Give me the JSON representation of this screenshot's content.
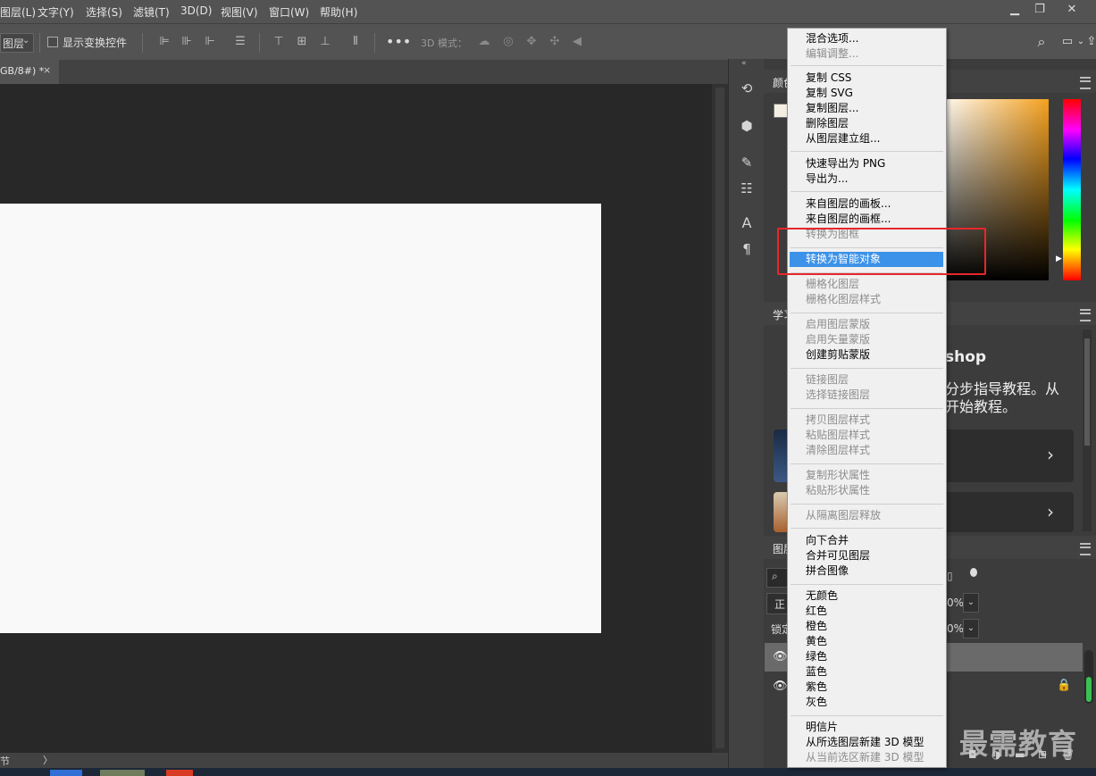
{
  "menubar": {
    "items": [
      "图层(L)",
      "文字(Y)",
      "选择(S)",
      "滤镜(T)",
      "3D(D)",
      "视图(V)",
      "窗口(W)",
      "帮助(H)"
    ],
    "window_controls": [
      "minimize-icon",
      "restore-icon",
      "close-icon"
    ]
  },
  "options": {
    "layer_select": "图层",
    "show_transform": "显示变换控件",
    "mode_3d": "3D 模式："
  },
  "tab": {
    "title": "GB/8#) *",
    "close": "×"
  },
  "status": {
    "left": "节",
    "arrow": "〉"
  },
  "panels": {
    "color_tab": "颜色",
    "learn_tab": "学习",
    "learn_heading": "shop",
    "learn_line1": "分步指导教程。从",
    "learn_line2": "开始教程。",
    "layers_tab": "图层",
    "blend_mode": "正",
    "opacity": "0%",
    "fill": "0%",
    "lock_label": "锁定"
  },
  "context_menu": {
    "items": [
      {
        "label": "混合选项...",
        "enabled": true
      },
      {
        "label": "编辑调整...",
        "enabled": false
      },
      {
        "label": "复制 CSS",
        "enabled": true
      },
      {
        "label": "复制 SVG",
        "enabled": true
      },
      {
        "label": "复制图层...",
        "enabled": true
      },
      {
        "label": "删除图层",
        "enabled": true
      },
      {
        "label": "从图层建立组...",
        "enabled": true
      },
      {
        "label": "快速导出为 PNG",
        "enabled": true
      },
      {
        "label": "导出为...",
        "enabled": true
      },
      {
        "label": "来自图层的画板...",
        "enabled": true
      },
      {
        "label": "来自图层的画框...",
        "enabled": true
      },
      {
        "label": "转换为图框",
        "enabled": false
      },
      {
        "label": "转换为智能对象",
        "enabled": true,
        "highlighted": true
      },
      {
        "label": "栅格化图层",
        "enabled": false
      },
      {
        "label": "栅格化图层样式",
        "enabled": false
      },
      {
        "label": "启用图层蒙版",
        "enabled": false
      },
      {
        "label": "启用矢量蒙版",
        "enabled": false
      },
      {
        "label": "创建剪贴蒙版",
        "enabled": true
      },
      {
        "label": "链接图层",
        "enabled": false
      },
      {
        "label": "选择链接图层",
        "enabled": false
      },
      {
        "label": "拷贝图层样式",
        "enabled": false
      },
      {
        "label": "粘贴图层样式",
        "enabled": false
      },
      {
        "label": "清除图层样式",
        "enabled": false
      },
      {
        "label": "复制形状属性",
        "enabled": false
      },
      {
        "label": "粘贴形状属性",
        "enabled": false
      },
      {
        "label": "从隔离图层释放",
        "enabled": false
      },
      {
        "label": "向下合并",
        "enabled": true
      },
      {
        "label": "合并可见图层",
        "enabled": true
      },
      {
        "label": "拼合图像",
        "enabled": true
      },
      {
        "label": "无颜色",
        "enabled": true
      },
      {
        "label": "红色",
        "enabled": true
      },
      {
        "label": "橙色",
        "enabled": true
      },
      {
        "label": "黄色",
        "enabled": true
      },
      {
        "label": "绿色",
        "enabled": true
      },
      {
        "label": "蓝色",
        "enabled": true
      },
      {
        "label": "紫色",
        "enabled": true
      },
      {
        "label": "灰色",
        "enabled": true
      },
      {
        "label": "明信片",
        "enabled": true
      },
      {
        "label": "从所选图层新建 3D 模型",
        "enabled": true
      },
      {
        "label": "从当前选区新建 3D 模型",
        "enabled": false
      }
    ]
  },
  "watermark": "最需教育",
  "colors": {
    "highlight": "#3c92e8",
    "annotation": "#e8262c"
  }
}
